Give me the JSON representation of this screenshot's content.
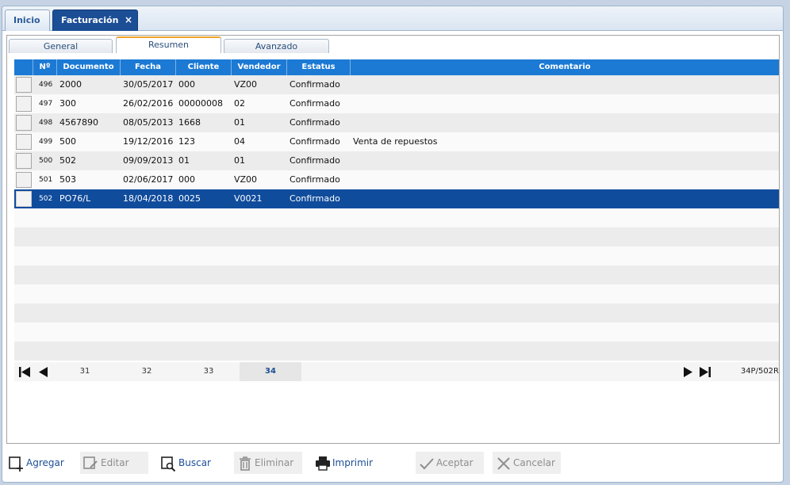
{
  "tabs": {
    "inicio": "Inicio",
    "facturacion": "Facturación",
    "close_glyph": "×"
  },
  "subtabs": {
    "general": "General",
    "resumen": "Resumen",
    "avanzado": "Avanzado"
  },
  "columns": {
    "num": "Nº",
    "documento": "Documento",
    "fecha": "Fecha",
    "cliente": "Cliente",
    "vendedor": "Vendedor",
    "estatus": "Estatus",
    "comentario": "Comentario"
  },
  "rows": [
    {
      "num": "496",
      "documento": "2000",
      "fecha": "30/05/2017",
      "cliente": "000",
      "vendedor": "VZ00",
      "estatus": "Confirmado",
      "comentario": ""
    },
    {
      "num": "497",
      "documento": "300",
      "fecha": "26/02/2016",
      "cliente": "00000008",
      "vendedor": "02",
      "estatus": "Confirmado",
      "comentario": ""
    },
    {
      "num": "498",
      "documento": "4567890",
      "fecha": "08/05/2013",
      "cliente": "1668",
      "vendedor": "01",
      "estatus": "Confirmado",
      "comentario": ""
    },
    {
      "num": "499",
      "documento": "500",
      "fecha": "19/12/2016",
      "cliente": "123",
      "vendedor": "04",
      "estatus": "Confirmado",
      "comentario": "Venta de repuestos"
    },
    {
      "num": "500",
      "documento": "502",
      "fecha": "09/09/2013",
      "cliente": "01",
      "vendedor": "01",
      "estatus": "Confirmado",
      "comentario": ""
    },
    {
      "num": "501",
      "documento": "503",
      "fecha": "02/06/2017",
      "cliente": "000",
      "vendedor": "VZ00",
      "estatus": "Confirmado",
      "comentario": ""
    },
    {
      "num": "502",
      "documento": "PO76/L",
      "fecha": "18/04/2018",
      "cliente": "0025",
      "vendedor": "V0021",
      "estatus": "Confirmado",
      "comentario": ""
    }
  ],
  "selected_row": 6,
  "pager": {
    "pages": [
      "31",
      "32",
      "33",
      "34"
    ],
    "current": "34",
    "info": "34P/502R"
  },
  "toolbar": {
    "agregar": "Agregar",
    "editar": "Editar",
    "buscar": "Buscar",
    "eliminar": "Eliminar",
    "imprimir": "Imprimir",
    "aceptar": "Aceptar",
    "cancelar": "Cancelar"
  },
  "colors": {
    "accent": "#1c4e96",
    "header": "#1c7ad4",
    "selected": "#104c9c",
    "active_tab_border": "#f0a52a"
  }
}
